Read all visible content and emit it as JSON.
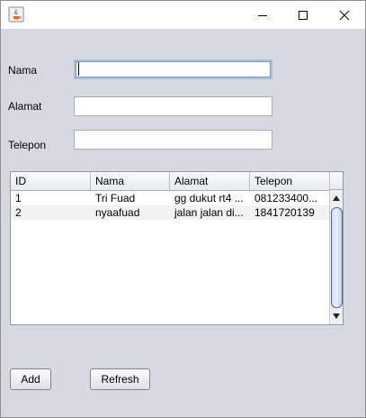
{
  "window": {
    "title": "",
    "controls": [
      "minimize-icon",
      "maximize-icon",
      "close-icon"
    ]
  },
  "form": {
    "nama_label": "Nama",
    "nama_value": "",
    "alamat_label": "Alamat",
    "alamat_value": "",
    "telepon_label": "Telepon",
    "telepon_value": ""
  },
  "table": {
    "columns": [
      "ID",
      "Nama",
      "Alamat",
      "Telepon"
    ],
    "rows": [
      [
        "1",
        "Tri Fuad",
        "gg dukut rt4 ...",
        "081233400..."
      ],
      [
        "2",
        "nyaafuad",
        "jalan jalan di...",
        "1841720139"
      ]
    ]
  },
  "buttons": {
    "add_label": "Add",
    "refresh_label": "Refresh"
  },
  "colors": {
    "background": "#d6d9df",
    "focus_border": "#a9c1dc",
    "scroll_thumb": "#c9ddf2"
  }
}
